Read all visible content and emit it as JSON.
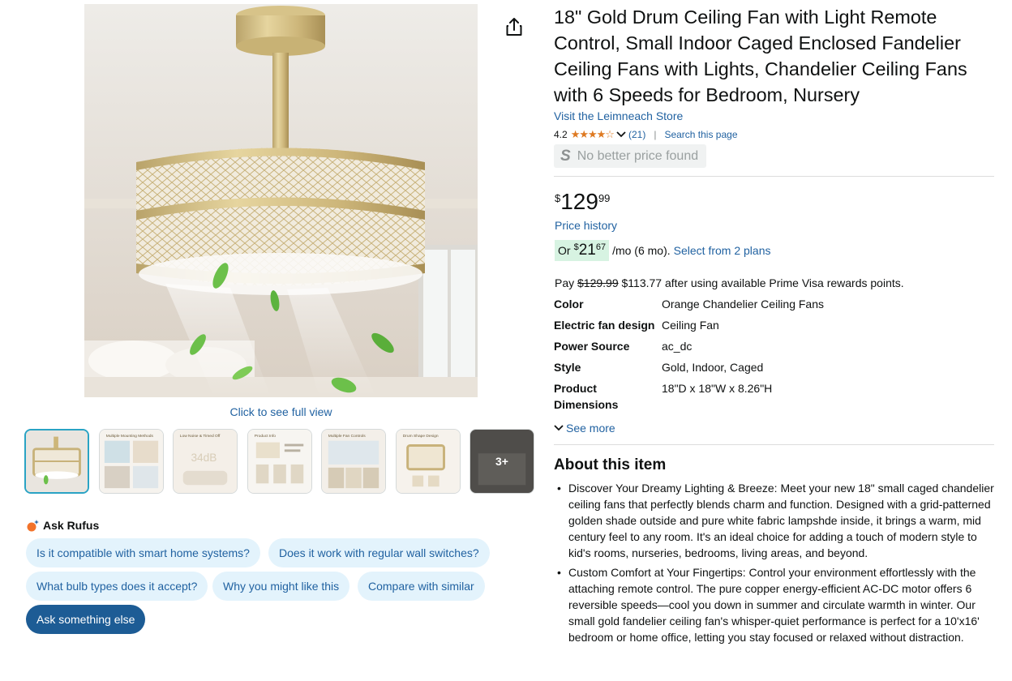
{
  "gallery": {
    "full_view_label": "Click to see full view",
    "more_label": "3+",
    "thumb_captions": [
      "Multiple Mounting Methods",
      "Low Noise & Timed Off",
      "Product Info",
      "Multiple Fan Controls",
      "Drum Shape Design"
    ],
    "thumb_big_text": "34dB"
  },
  "icons": {
    "share": "share-icon",
    "rufus": "rufus-icon",
    "chevron": "chevron-down-icon"
  },
  "colors": {
    "link": "#2162a1",
    "star": "#de7921",
    "installment_bg": "#d7f3e2",
    "chip_bg": "#e3f3fc",
    "chip_dark": "#1d5c95",
    "thumb_selected": "#2aa3c4"
  },
  "rufus": {
    "heading": "Ask Rufus",
    "chips": [
      "Is it compatible with smart home systems?",
      "Does it work with regular wall switches?",
      "What bulb types does it accept?",
      "Why you might like this",
      "Compare with similar",
      "Ask something else"
    ]
  },
  "product": {
    "title": "18\" Gold Drum Ceiling Fan with Light Remote Control, Small Indoor Caged Enclosed Fandelier Ceiling Fans with Lights, Chandelier Ceiling Fans with 6 Speeds for Bedroom, Nursery",
    "store": "Visit the Leimneach Store",
    "rating": "4.2",
    "rating_value": 4.2,
    "stars_glyphs": "★★★★☆",
    "review_count": "(21)",
    "search_page": "Search this page",
    "no_better_price_logo": "S",
    "no_better_price": "No better price found"
  },
  "pricing": {
    "currency": "$",
    "whole": "129",
    "fraction": "99",
    "price_history": "Price history",
    "installment_or": "Or",
    "installment_whole": "21",
    "installment_fraction": "67",
    "installment_term": "/mo (6 mo).",
    "installment_link": "Select from 2 plans",
    "visa_prefix": "Pay",
    "visa_old": "$129.99",
    "visa_text": "$113.77 after using available Prime Visa rewards points."
  },
  "specs": [
    {
      "key": "Color",
      "value": "Orange Chandelier Ceiling Fans"
    },
    {
      "key": "Electric fan design",
      "value": "Ceiling Fan"
    },
    {
      "key": "Power Source",
      "value": "ac_dc"
    },
    {
      "key": "Style",
      "value": "Gold, Indoor, Caged"
    },
    {
      "key": "Product Dimensions",
      "value": "18\"D x 18\"W x 8.26\"H"
    }
  ],
  "see_more": "See more",
  "about": {
    "heading": "About this item",
    "bullets": [
      "Discover Your Dreamy Lighting & Breeze: Meet your new 18\" small caged chandelier ceiling fans that perfectly blends charm and function. Designed with a grid-patterned golden shade outside and pure white fabric lampshde inside, it brings a warm, mid century feel to any room. It's an ideal choice for adding a touch of modern style to kid's rooms, nurseries, bedrooms, living areas, and beyond.",
      "Custom Comfort at Your Fingertips: Control your environment effortlessly with the attaching remote control. The pure copper energy-efficient AC-DC motor offers 6 reversible speeds—cool you down in summer and circulate warmth in winter. Our small gold fandelier ceiling fan's whisper-quiet performance is perfect for a 10'x16' bedroom or home office, letting you stay focused or relaxed without distraction."
    ]
  }
}
